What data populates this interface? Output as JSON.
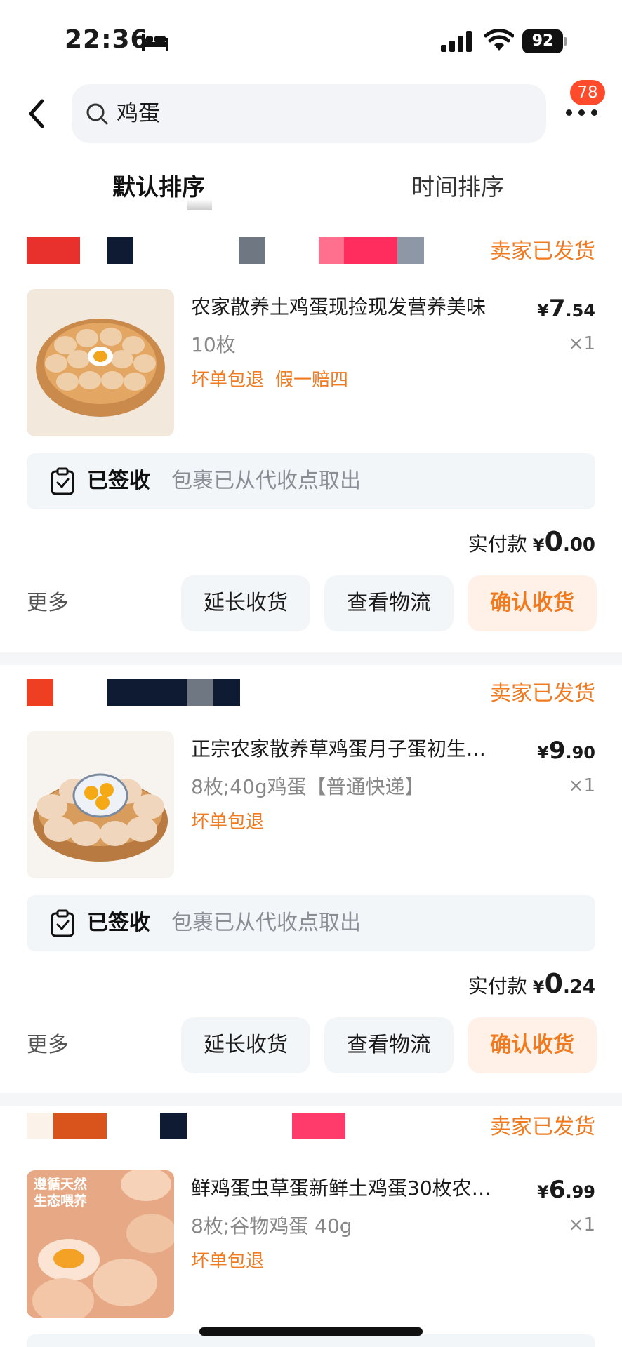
{
  "status_bar": {
    "time": "22:36",
    "battery": "92"
  },
  "search": {
    "query": "鸡蛋",
    "badge_count": "78"
  },
  "tabs": [
    {
      "label": "默认排序",
      "active": true
    },
    {
      "label": "时间排序",
      "active": false
    }
  ],
  "orders": [
    {
      "status": "卖家已发货",
      "shop_blocks": [
        "#e8302c",
        "#0f1a33",
        "#6f7782",
        "#ff6f8e",
        "#ff2c5e",
        "#8e97a5"
      ],
      "title": "农家散养土鸡蛋现捡现发营养美味",
      "price_symbol": "¥",
      "price_int": "7",
      "price_dec": ".54",
      "spec": "10枚",
      "qty": "×1",
      "tags": [
        "坏单包退",
        "假一赔四"
      ],
      "logistics_state": "已签收",
      "logistics_desc": "包裹已从代收点取出",
      "paid_label": "实付款",
      "paid_symbol": "¥",
      "paid_int": "0",
      "paid_dec": ".00",
      "more": "更多",
      "btn_extend": "延长收货",
      "btn_logistics": "查看物流",
      "btn_confirm": "确认收货"
    },
    {
      "status": "卖家已发货",
      "shop_blocks": [
        "#ee3f22",
        "#0f1a33",
        "#6f7782"
      ],
      "title": "正宗农家散养草鸡蛋月子蛋初生…",
      "price_symbol": "¥",
      "price_int": "9",
      "price_dec": ".90",
      "spec": "8枚;40g鸡蛋【普通快递】",
      "qty": "×1",
      "tags": [
        "坏单包退"
      ],
      "logistics_state": "已签收",
      "logistics_desc": "包裹已从代收点取出",
      "paid_label": "实付款",
      "paid_symbol": "¥",
      "paid_int": "0",
      "paid_dec": ".24",
      "more": "更多",
      "btn_extend": "延长收货",
      "btn_logistics": "查看物流",
      "btn_confirm": "确认收货"
    },
    {
      "status": "卖家已发货",
      "shop_blocks": [
        "#d9531d",
        "#0f1a33",
        "#ff3b6b"
      ],
      "title": "鲜鸡蛋虫草蛋新鲜土鸡蛋30枚农…",
      "price_symbol": "¥",
      "price_int": "6",
      "price_dec": ".99",
      "spec": "8枚;谷物鸡蛋 40g",
      "qty": "×1",
      "tags": [
        "坏单包退"
      ],
      "thumb_text": [
        "遵循天然",
        "生态喂养"
      ]
    }
  ]
}
